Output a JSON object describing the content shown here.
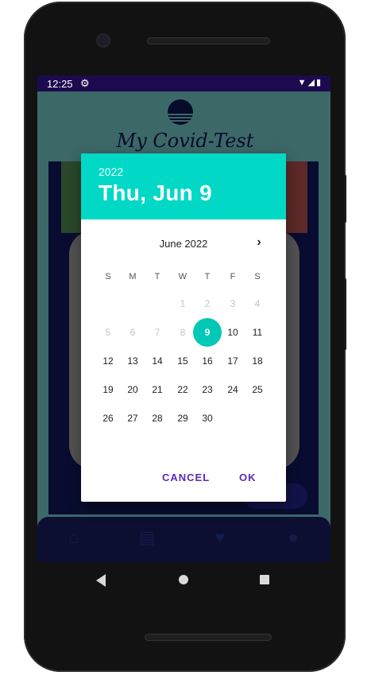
{
  "status_bar": {
    "time": "12:25",
    "settings_icon": "gear-icon",
    "right_icons": "wifi-icon signal-icon battery-icon"
  },
  "app": {
    "title": "My Covid-Test",
    "logo_icon": "sunset-logo-icon"
  },
  "bottom_nav": [
    {
      "icon": "home-icon",
      "glyph": "⌂"
    },
    {
      "icon": "receipt-icon",
      "glyph": "▤"
    },
    {
      "icon": "heart-icon",
      "glyph": "♥"
    },
    {
      "icon": "person-icon",
      "glyph": "●"
    }
  ],
  "date_picker": {
    "header_year": "2022",
    "header_date": "Thu, Jun 9",
    "month_label": "June 2022",
    "weekdays": [
      "S",
      "M",
      "T",
      "W",
      "T",
      "F",
      "S"
    ],
    "days": [
      {
        "d": "1",
        "enabled": false
      },
      {
        "d": "2",
        "enabled": false
      },
      {
        "d": "3",
        "enabled": false
      },
      {
        "d": "4",
        "enabled": false
      },
      {
        "d": "5",
        "enabled": false
      },
      {
        "d": "6",
        "enabled": false
      },
      {
        "d": "7",
        "enabled": false
      },
      {
        "d": "8",
        "enabled": false
      },
      {
        "d": "9",
        "enabled": true,
        "selected": true
      },
      {
        "d": "10",
        "enabled": true
      },
      {
        "d": "11",
        "enabled": true
      },
      {
        "d": "12",
        "enabled": true
      },
      {
        "d": "13",
        "enabled": true
      },
      {
        "d": "14",
        "enabled": true
      },
      {
        "d": "15",
        "enabled": true
      },
      {
        "d": "16",
        "enabled": true
      },
      {
        "d": "17",
        "enabled": true
      },
      {
        "d": "18",
        "enabled": true
      },
      {
        "d": "19",
        "enabled": true
      },
      {
        "d": "20",
        "enabled": true
      },
      {
        "d": "21",
        "enabled": true
      },
      {
        "d": "22",
        "enabled": true
      },
      {
        "d": "23",
        "enabled": true
      },
      {
        "d": "24",
        "enabled": true
      },
      {
        "d": "25",
        "enabled": true
      },
      {
        "d": "26",
        "enabled": true
      },
      {
        "d": "27",
        "enabled": true
      },
      {
        "d": "28",
        "enabled": true
      },
      {
        "d": "29",
        "enabled": true
      },
      {
        "d": "30",
        "enabled": true
      }
    ],
    "cancel_label": "CANCEL",
    "ok_label": "OK",
    "accent_color": "#02d8c6",
    "button_color": "#5b2ab8"
  }
}
